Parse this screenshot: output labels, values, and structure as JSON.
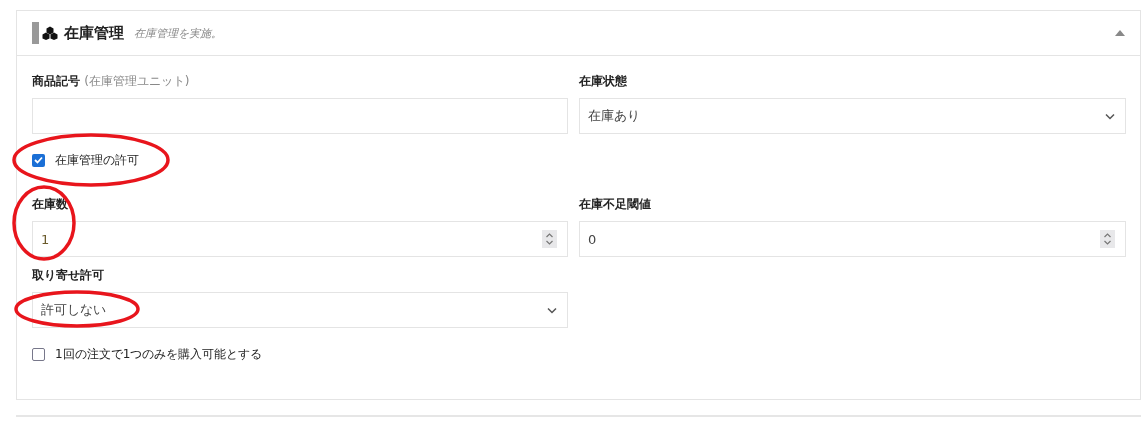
{
  "panel": {
    "title": "在庫管理",
    "subtitle": "在庫管理を実施。",
    "expanded": true,
    "fields": [
      {
        "kind": "text",
        "label": "商品記号",
        "hint": "(在庫管理ユニット)",
        "highlighted": false
      },
      {
        "kind": "select",
        "label": "在庫状態",
        "value": "在庫あり",
        "highlighted": false
      },
      {
        "kind": "checkbox",
        "label": "在庫管理の許可",
        "checked": true,
        "highlighted": true
      },
      {
        "kind": "number",
        "label": "在庫数",
        "value": "1",
        "highlighted": true
      },
      {
        "kind": "number",
        "label": "在庫不足閾値",
        "value": "0",
        "highlighted": false
      },
      {
        "kind": "select",
        "label": "取り寄せ許可",
        "value": "許可しない",
        "highlighted": true
      },
      {
        "kind": "checkbox",
        "label": "1回の注文で1つのみを購入可能とする",
        "checked": false,
        "highlighted": false
      }
    ]
  }
}
